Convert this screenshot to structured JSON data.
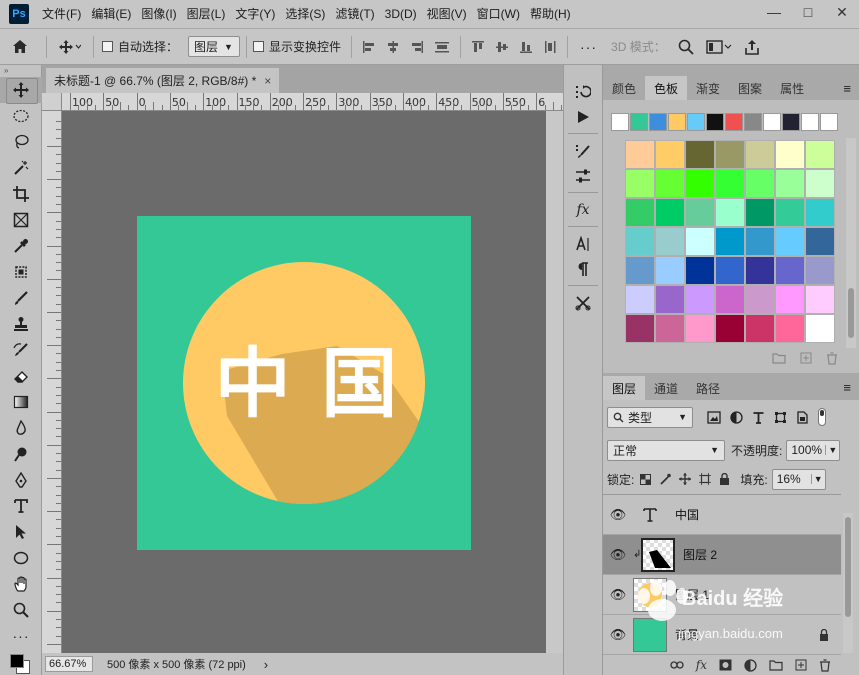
{
  "app": {
    "logo": "Ps"
  },
  "menu": [
    "文件(F)",
    "编辑(E)",
    "图像(I)",
    "图层(L)",
    "文字(Y)",
    "选择(S)",
    "滤镜(T)",
    "3D(D)",
    "视图(V)",
    "窗口(W)",
    "帮助(H)"
  ],
  "window_controls": {
    "minimize": "—",
    "maximize": "□",
    "close": "✕"
  },
  "options": {
    "auto_select_label": "自动选择：",
    "auto_select_value": "图层",
    "show_transform_label": "显示变换控件",
    "more": "···",
    "mode_3d_label": "3D 模式："
  },
  "document": {
    "tab_title": "未标题-1 @ 66.7% (图层 2, RGB/8#) *",
    "close": "×",
    "ruler_ticks": [
      "100",
      "50",
      "0",
      "50",
      "100",
      "150",
      "200",
      "250",
      "300",
      "350",
      "400",
      "450",
      "500",
      "550",
      "6"
    ],
    "zoom": "66.67%",
    "status": "500 像素 x 500 像素 (72 ppi)",
    "status_arrow": "›"
  },
  "artwork": {
    "text": "中 国",
    "bg_color": "#33c896",
    "circle_color": "#ffca64",
    "shadow_color": "#dcaa50"
  },
  "color_panel": {
    "tabs": [
      "颜色",
      "色板",
      "渐变",
      "图案",
      "属性"
    ],
    "active_tab": "色板",
    "recent_swatches": [
      "#ffffff",
      "#33c896",
      "#3d8fdc",
      "#ffca64",
      "#66cbf7",
      "#111111",
      "#f05050",
      "#888888",
      "#ffffff",
      "#222233",
      "#ffffff",
      "#ffffff"
    ],
    "grid": [
      [
        "#ffcc99",
        "#ffcc66",
        "#666633",
        "#999966",
        "#cccc99",
        "#ffffcc",
        "#ccff99"
      ],
      [
        "#99ff66",
        "#66ff33",
        "#33ff00",
        "#33ff33",
        "#66ff66",
        "#99ff99",
        "#ccffcc"
      ],
      [
        "#33cc66",
        "#00cc66",
        "#66cc99",
        "#99ffcc",
        "#009966",
        "#33cc99",
        "#33cccc"
      ],
      [
        "#66cccc",
        "#99cccc",
        "#ccffff",
        "#0099cc",
        "#3399cc",
        "#66ccff",
        "#336699"
      ],
      [
        "#6699cc",
        "#99ccff",
        "#003399",
        "#3366cc",
        "#333399",
        "#6666cc",
        "#9999cc"
      ],
      [
        "#ccccff",
        "#9966cc",
        "#cc99ff",
        "#cc66cc",
        "#cc99cc",
        "#ff99ff",
        "#ffccff"
      ],
      [
        "#993366",
        "#cc6699",
        "#ff99cc",
        "#990033",
        "#cc3366",
        "#ff6699",
        "#ffffff"
      ]
    ]
  },
  "layers_panel": {
    "tabs": [
      "图层",
      "通道",
      "路径"
    ],
    "active_tab": "图层",
    "filter_kind": "类型",
    "blend_mode": "正常",
    "opacity_label": "不透明度:",
    "opacity": "100%",
    "lock_label": "锁定:",
    "fill_label": "填充:",
    "fill": "16%",
    "layers": [
      {
        "name": "中国",
        "type": "text",
        "selected": false
      },
      {
        "name": "图层 2",
        "type": "shadow",
        "selected": true
      },
      {
        "name": "图层 1",
        "type": "circle",
        "selected": false
      },
      {
        "name": "背景",
        "type": "background",
        "selected": false
      }
    ]
  },
  "watermark": {
    "brand": "Baidu 经验",
    "url": "jingyan.baidu.com"
  }
}
